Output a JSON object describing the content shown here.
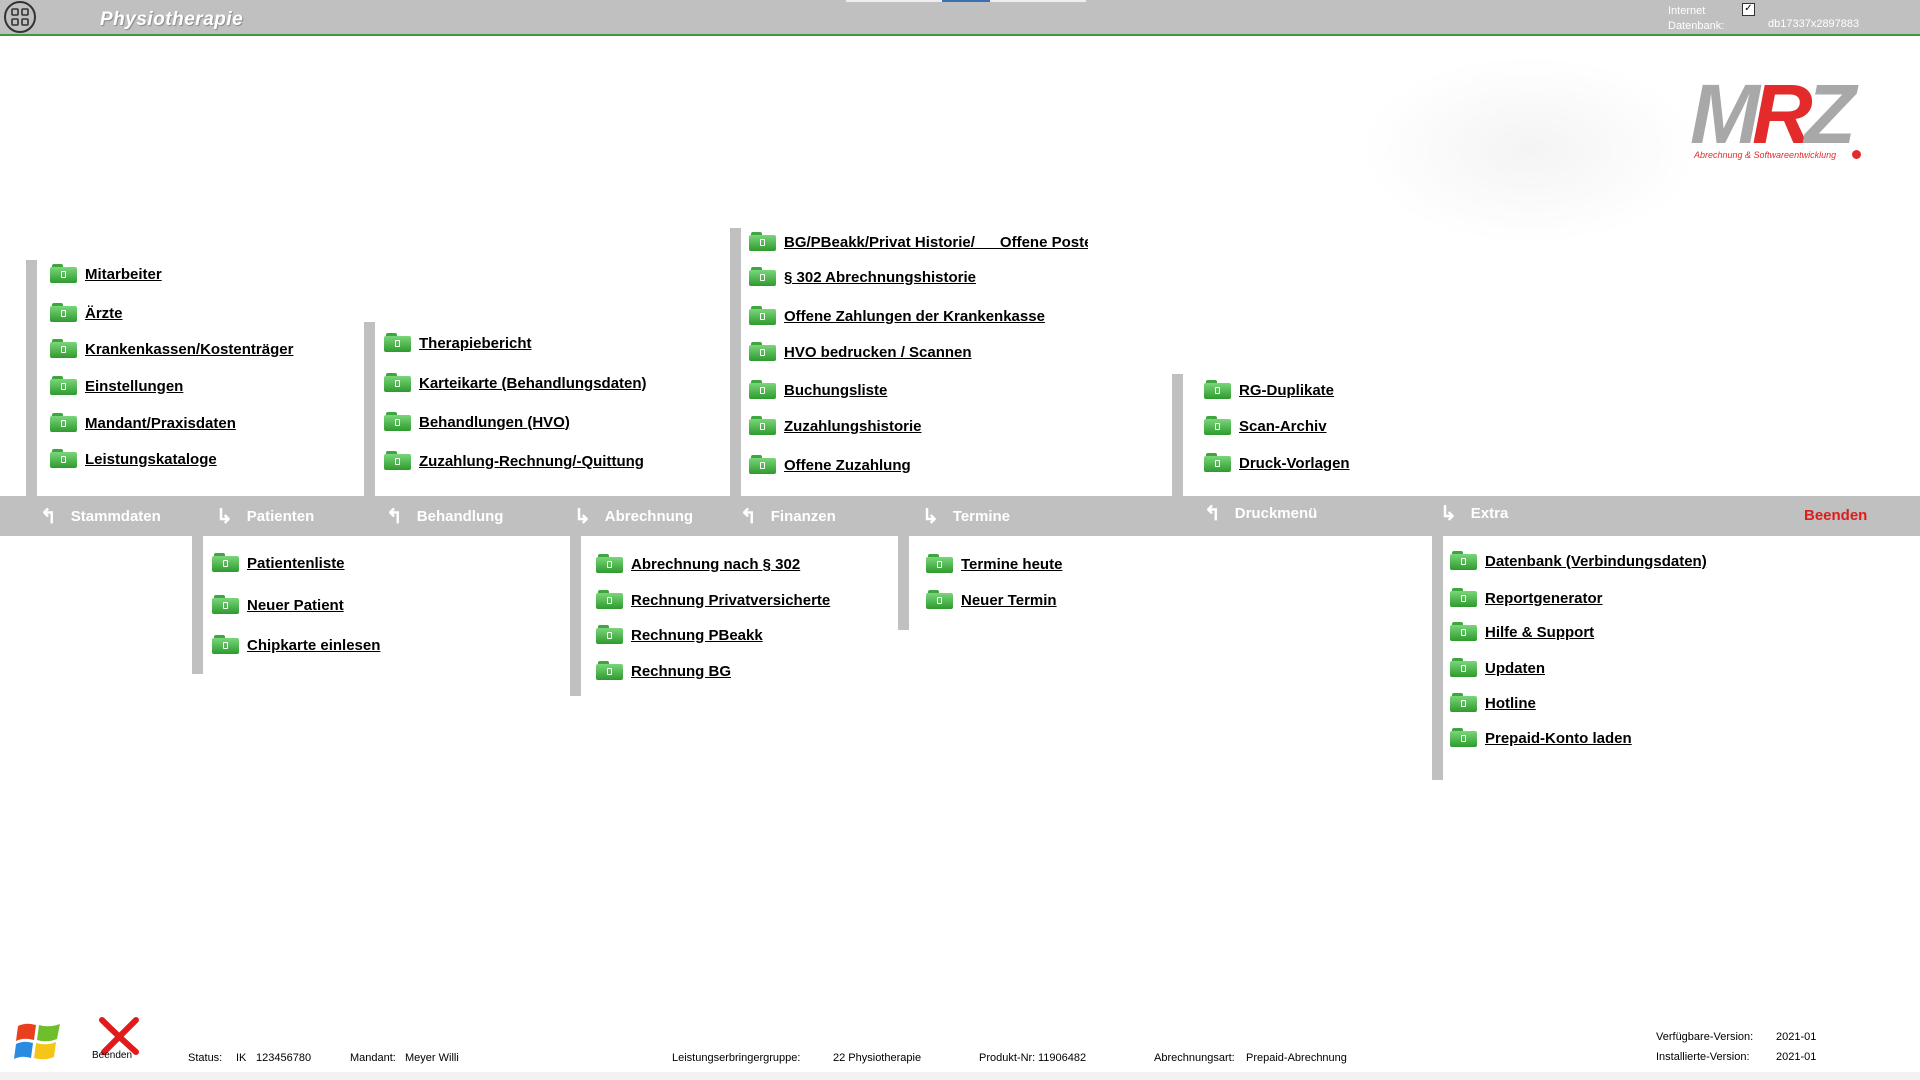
{
  "header": {
    "title": "Physiotherapie",
    "internet_label": "Internet",
    "internet_checked": true,
    "database_label": "Datenbank:",
    "database_value": "db17337x2897883"
  },
  "logo": {
    "letters": [
      "M",
      "R",
      "Z"
    ],
    "subtitle": "Abrechnung & Softwareentwicklung"
  },
  "nav": [
    {
      "label": "Stammdaten",
      "arrow": "up"
    },
    {
      "label": "Patienten",
      "arrow": "down"
    },
    {
      "label": "Behandlung",
      "arrow": "up"
    },
    {
      "label": "Abrechnung",
      "arrow": "down"
    },
    {
      "label": "Finanzen",
      "arrow": "up"
    },
    {
      "label": "Termine",
      "arrow": "down"
    },
    {
      "label": "Druckmenü",
      "arrow": "up"
    },
    {
      "label": "Extra",
      "arrow": "down"
    },
    {
      "label": "Beenden",
      "arrow": "none"
    }
  ],
  "menus": {
    "stammdaten": [
      "Mitarbeiter",
      "Ärzte",
      "Krankenkassen/Kostenträger",
      "Einstellungen",
      "Mandant/Praxisdaten",
      "Leistungskataloge"
    ],
    "behandlung": [
      "Therapiebericht",
      "Karteikarte (Behandlungsdaten)",
      "Behandlungen (HVO)",
      "Zuzahlung-Rechnung/-Quittung"
    ],
    "finanzen": [
      "BG/PBeakk/Privat Historie/      Offene Poste",
      "§ 302 Abrechnungshistorie",
      "Offene Zahlungen der Krankenkasse",
      "HVO bedrucken / Scannen",
      "Buchungsliste",
      "Zuzahlungshistorie",
      "Offene Zuzahlung"
    ],
    "druckmenue": [
      "RG-Duplikate",
      "Scan-Archiv",
      "Druck-Vorlagen"
    ],
    "patienten": [
      "Patientenliste",
      "Neuer Patient",
      "Chipkarte einlesen"
    ],
    "abrechnung": [
      "Abrechnung nach  § 302",
      "Rechnung Privatversicherte",
      "Rechnung PBeakk",
      "Rechnung BG"
    ],
    "termine": [
      "Termine heute",
      "Neuer Termin"
    ],
    "extra": [
      "Datenbank (Verbindungsdaten)",
      "Reportgenerator",
      "Hilfe & Support",
      "Updaten",
      "Hotline",
      "Prepaid-Konto laden"
    ]
  },
  "statusbar": {
    "exit_label": "Beenden",
    "status_label": "Status:",
    "ik_label": "IK",
    "ik_value": "123456780",
    "mandant_label": "Mandant:",
    "mandant_value": "Meyer Willi",
    "group_label": "Leistungserbringergruppe:",
    "group_value": "22  Physiotherapie",
    "product_label": "Produkt-Nr:",
    "product_value": "11906482",
    "billing_label": "Abrechnungsart:",
    "billing_value": "Prepaid-Abrechnung",
    "available_label": "Verfügbare-Version:",
    "available_value": "2021-01",
    "installed_label": "Installierte-Version:",
    "installed_value": "2021-01"
  },
  "colors": {
    "bar_grey": "#c0c0c0",
    "folder_green": "#3ea63e",
    "exit_red": "#e01b1b",
    "logo_red": "#e32b2b"
  }
}
